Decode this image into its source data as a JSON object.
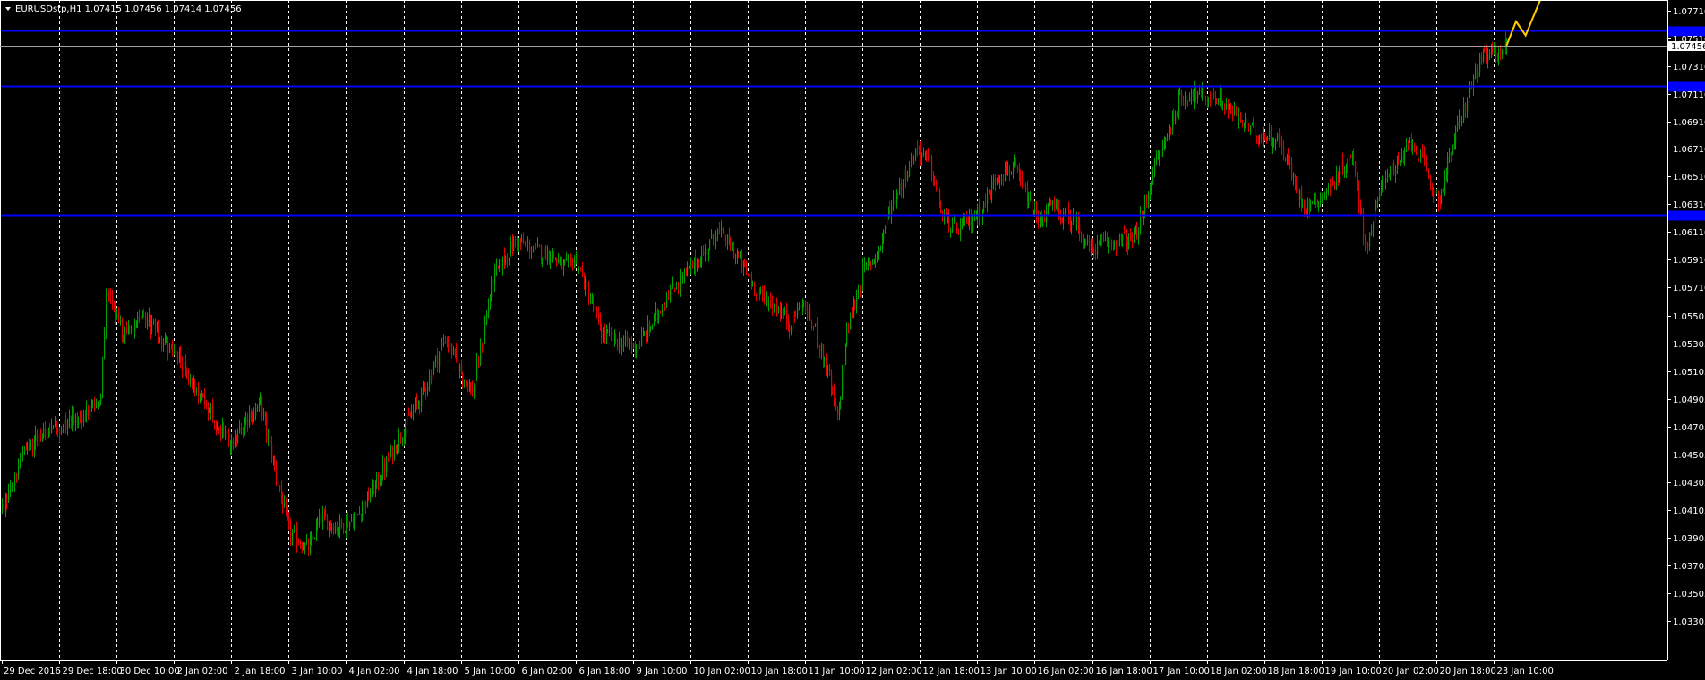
{
  "chart_data": {
    "type": "candlestick",
    "symbol_header": "EURUSDstp,H1  1.07415 1.07456 1.07414 1.07456",
    "current_price_label": "1.07456",
    "current_price": 1.07456,
    "ylim": [
      1.0302,
      1.07785
    ],
    "grid": "vertical-dashed",
    "x_tick_labels": [
      "29 Dec 2016",
      "29 Dec 18:00",
      "30 Dec 10:00",
      "2 Jan 02:00",
      "2 Jan 18:00",
      "3 Jan 10:00",
      "4 Jan 02:00",
      "4 Jan 18:00",
      "5 Jan 10:00",
      "6 Jan 02:00",
      "6 Jan 18:00",
      "9 Jan 10:00",
      "10 Jan 02:00",
      "10 Jan 18:00",
      "11 Jan 10:00",
      "12 Jan 02:00",
      "12 Jan 18:00",
      "13 Jan 10:00",
      "16 Jan 02:00",
      "16 Jan 18:00",
      "17 Jan 10:00",
      "18 Jan 02:00",
      "18 Jan 18:00",
      "19 Jan 10:00",
      "20 Jan 02:00",
      "20 Jan 18:00",
      "23 Jan 10:00"
    ],
    "y_tick_labels": [
      "1.07710",
      "1.07510",
      "1.07310",
      "1.07110",
      "1.06910",
      "1.06710",
      "1.06510",
      "1.06310",
      "1.06110",
      "1.05910",
      "1.05710",
      "1.05505",
      "1.05305",
      "1.05105",
      "1.04905",
      "1.04705",
      "1.04505",
      "1.04305",
      "1.04105",
      "1.03905",
      "1.03705",
      "1.03505",
      "1.03305"
    ],
    "horizontal_levels": [
      1.07565,
      1.07166,
      1.06235
    ],
    "level_tag_color": "#0000ff",
    "colors": {
      "background": "#000000",
      "bull": "#00a000",
      "bear": "#e00000",
      "level": "#0000ff",
      "grid": "#ffffff",
      "projection": "#ffcc00"
    },
    "keypoints": [
      {
        "x": 0,
        "y": 1.0412
      },
      {
        "x": 12,
        "y": 1.0448
      },
      {
        "x": 22,
        "y": 1.0462
      },
      {
        "x": 38,
        "y": 1.0472
      },
      {
        "x": 52,
        "y": 1.0478
      },
      {
        "x": 62,
        "y": 1.0492
      },
      {
        "x": 65,
        "y": 1.0568
      },
      {
        "x": 70,
        "y": 1.0555
      },
      {
        "x": 76,
        "y": 1.0535
      },
      {
        "x": 84,
        "y": 1.0548
      },
      {
        "x": 93,
        "y": 1.0545
      },
      {
        "x": 100,
        "y": 1.0532
      },
      {
        "x": 110,
        "y": 1.0522
      },
      {
        "x": 118,
        "y": 1.0505
      },
      {
        "x": 128,
        "y": 1.0485
      },
      {
        "x": 142,
        "y": 1.0458
      },
      {
        "x": 150,
        "y": 1.0468
      },
      {
        "x": 156,
        "y": 1.0478
      },
      {
        "x": 162,
        "y": 1.0488
      },
      {
        "x": 170,
        "y": 1.0445
      },
      {
        "x": 180,
        "y": 1.0395
      },
      {
        "x": 192,
        "y": 1.0382
      },
      {
        "x": 200,
        "y": 1.0405
      },
      {
        "x": 210,
        "y": 1.0398
      },
      {
        "x": 222,
        "y": 1.0405
      },
      {
        "x": 236,
        "y": 1.0432
      },
      {
        "x": 250,
        "y": 1.0465
      },
      {
        "x": 264,
        "y": 1.0495
      },
      {
        "x": 278,
        "y": 1.0535
      },
      {
        "x": 288,
        "y": 1.051
      },
      {
        "x": 295,
        "y": 1.0495
      },
      {
        "x": 300,
        "y": 1.0525
      },
      {
        "x": 308,
        "y": 1.0578
      },
      {
        "x": 322,
        "y": 1.0605
      },
      {
        "x": 334,
        "y": 1.0598
      },
      {
        "x": 345,
        "y": 1.0595
      },
      {
        "x": 352,
        "y": 1.0585
      },
      {
        "x": 360,
        "y": 1.0592
      },
      {
        "x": 368,
        "y": 1.0565
      },
      {
        "x": 376,
        "y": 1.0538
      },
      {
        "x": 386,
        "y": 1.0532
      },
      {
        "x": 398,
        "y": 1.0528
      },
      {
        "x": 408,
        "y": 1.0545
      },
      {
        "x": 418,
        "y": 1.0568
      },
      {
        "x": 430,
        "y": 1.0582
      },
      {
        "x": 442,
        "y": 1.0598
      },
      {
        "x": 448,
        "y": 1.0612
      },
      {
        "x": 454,
        "y": 1.0605
      },
      {
        "x": 462,
        "y": 1.0592
      },
      {
        "x": 470,
        "y": 1.0575
      },
      {
        "x": 478,
        "y": 1.0562
      },
      {
        "x": 486,
        "y": 1.0558
      },
      {
        "x": 494,
        "y": 1.0545
      },
      {
        "x": 502,
        "y": 1.056
      },
      {
        "x": 510,
        "y": 1.054
      },
      {
        "x": 518,
        "y": 1.051
      },
      {
        "x": 524,
        "y": 1.0475
      },
      {
        "x": 530,
        "y": 1.054
      },
      {
        "x": 540,
        "y": 1.0582
      },
      {
        "x": 550,
        "y": 1.0598
      },
      {
        "x": 556,
        "y": 1.0625
      },
      {
        "x": 566,
        "y": 1.0652
      },
      {
        "x": 574,
        "y": 1.0672
      },
      {
        "x": 582,
        "y": 1.066
      },
      {
        "x": 590,
        "y": 1.0622
      },
      {
        "x": 598,
        "y": 1.0612
      },
      {
        "x": 608,
        "y": 1.062
      },
      {
        "x": 616,
        "y": 1.063
      },
      {
        "x": 624,
        "y": 1.0652
      },
      {
        "x": 634,
        "y": 1.0658
      },
      {
        "x": 642,
        "y": 1.0638
      },
      {
        "x": 650,
        "y": 1.0618
      },
      {
        "x": 658,
        "y": 1.063
      },
      {
        "x": 666,
        "y": 1.0622
      },
      {
        "x": 674,
        "y": 1.0618
      },
      {
        "x": 682,
        "y": 1.0598
      },
      {
        "x": 690,
        "y": 1.0602
      },
      {
        "x": 700,
        "y": 1.0605
      },
      {
        "x": 710,
        "y": 1.0605
      },
      {
        "x": 716,
        "y": 1.0625
      },
      {
        "x": 722,
        "y": 1.0655
      },
      {
        "x": 730,
        "y": 1.0678
      },
      {
        "x": 738,
        "y": 1.0705
      },
      {
        "x": 746,
        "y": 1.0712
      },
      {
        "x": 754,
        "y": 1.0708
      },
      {
        "x": 762,
        "y": 1.0708
      },
      {
        "x": 770,
        "y": 1.07
      },
      {
        "x": 778,
        "y": 1.069
      },
      {
        "x": 786,
        "y": 1.0683
      },
      {
        "x": 794,
        "y": 1.068
      },
      {
        "x": 800,
        "y": 1.0678
      },
      {
        "x": 806,
        "y": 1.0665
      },
      {
        "x": 812,
        "y": 1.064
      },
      {
        "x": 818,
        "y": 1.063
      },
      {
        "x": 826,
        "y": 1.0635
      },
      {
        "x": 834,
        "y": 1.0645
      },
      {
        "x": 842,
        "y": 1.066
      },
      {
        "x": 848,
        "y": 1.0665
      },
      {
        "x": 852,
        "y": 1.0625
      },
      {
        "x": 856,
        "y": 1.06
      },
      {
        "x": 862,
        "y": 1.0628
      },
      {
        "x": 868,
        "y": 1.0655
      },
      {
        "x": 876,
        "y": 1.0658
      },
      {
        "x": 884,
        "y": 1.0678
      },
      {
        "x": 890,
        "y": 1.0665
      },
      {
        "x": 896,
        "y": 1.0645
      },
      {
        "x": 902,
        "y": 1.0635
      },
      {
        "x": 908,
        "y": 1.0665
      },
      {
        "x": 914,
        "y": 1.069
      },
      {
        "x": 920,
        "y": 1.071
      },
      {
        "x": 926,
        "y": 1.0732
      },
      {
        "x": 932,
        "y": 1.0738
      },
      {
        "x": 938,
        "y": 1.0742
      },
      {
        "x": 944,
        "y": 1.07456
      }
    ],
    "projection": [
      {
        "x": 944,
        "y": 1.07456
      },
      {
        "x": 950,
        "y": 1.0763
      },
      {
        "x": 956,
        "y": 1.0753
      },
      {
        "x": 965,
        "y": 1.0778
      }
    ]
  }
}
